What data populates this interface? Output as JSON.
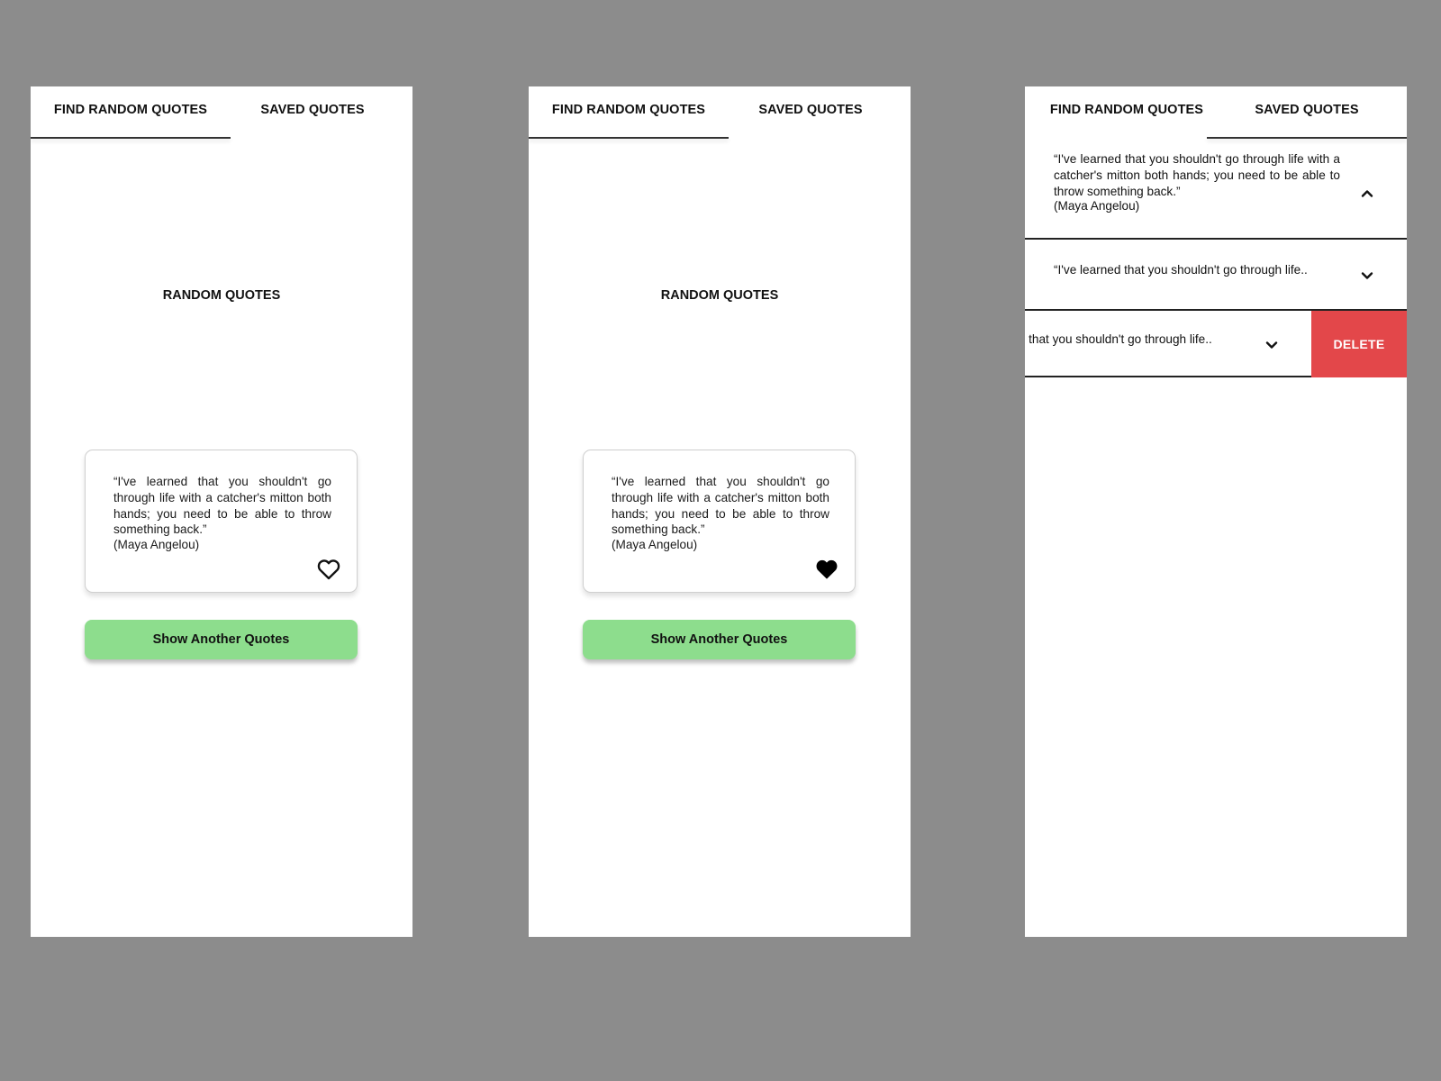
{
  "tabs": {
    "find": "FIND RANDOM QUOTES",
    "saved": "SAVED QUOTES"
  },
  "random_screen": {
    "title": "RANDOM QUOTES",
    "button_label": "Show Another Quotes",
    "button_color": "#8ddd8d"
  },
  "quote": {
    "text": "“I've learned that you shouldn't go through life with a catcher's mitton both hands; you need to be able to throw something back.”",
    "author": "(Maya Angelou)"
  },
  "screens": [
    {
      "active_tab": "find",
      "favorite": false,
      "heart_icon": "heart-outline-icon"
    },
    {
      "active_tab": "find",
      "favorite": true,
      "heart_icon": "heart-filled-icon"
    },
    {
      "active_tab": "saved"
    }
  ],
  "saved_list": {
    "items": [
      {
        "state": "expanded",
        "text": "“I've learned that you shouldn't go through life with a catcher's mitton both hands; you need to be able to throw something back.”",
        "author": "(Maya Angelou)",
        "icon": "chevron-up-icon"
      },
      {
        "state": "collapsed",
        "preview": "“I've learned that you shouldn't go through life..",
        "icon": "chevron-down-icon"
      },
      {
        "state": "swiped",
        "preview": "“I've learned that you shouldn't go through life..",
        "icon": "chevron-down-icon",
        "action_label": "DELETE",
        "action_color": "#e3474a"
      }
    ]
  }
}
